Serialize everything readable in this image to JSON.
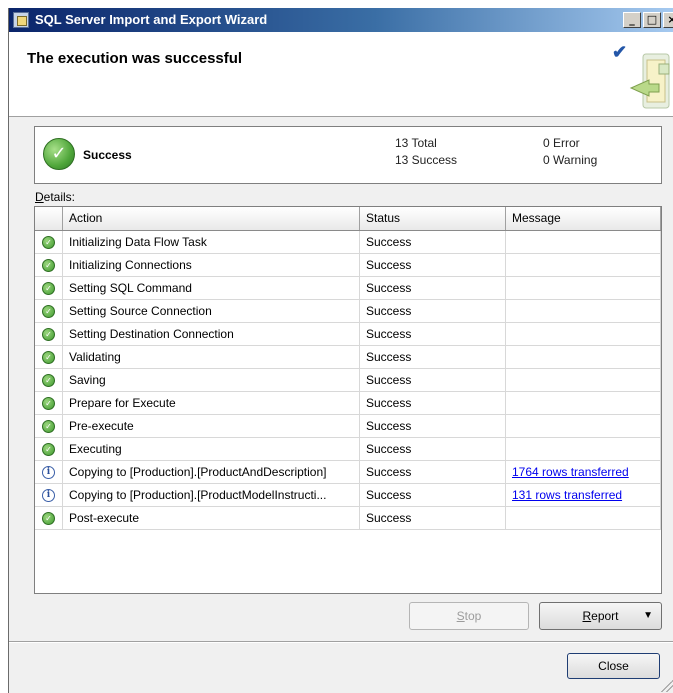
{
  "window": {
    "title": "SQL Server Import and Export Wizard",
    "controls": {
      "minimize": "_",
      "maximize": "□",
      "close": "×"
    }
  },
  "header": {
    "title": "The execution was successful"
  },
  "summary": {
    "status": "Success",
    "total": "13 Total",
    "success": "13 Success",
    "error": "0 Error",
    "warning": "0 Warning"
  },
  "details": {
    "label_accel": "D",
    "label_rest": "etails:",
    "columns": {
      "action": "Action",
      "status": "Status",
      "message": "Message"
    },
    "rows": [
      {
        "icon": "success",
        "action": "Initializing Data Flow Task",
        "status": "Success",
        "message": ""
      },
      {
        "icon": "success",
        "action": "Initializing Connections",
        "status": "Success",
        "message": ""
      },
      {
        "icon": "success",
        "action": "Setting SQL Command",
        "status": "Success",
        "message": ""
      },
      {
        "icon": "success",
        "action": "Setting Source Connection",
        "status": "Success",
        "message": ""
      },
      {
        "icon": "success",
        "action": "Setting Destination Connection",
        "status": "Success",
        "message": ""
      },
      {
        "icon": "success",
        "action": "Validating",
        "status": "Success",
        "message": ""
      },
      {
        "icon": "success",
        "action": "Saving",
        "status": "Success",
        "message": ""
      },
      {
        "icon": "success",
        "action": "Prepare for Execute",
        "status": "Success",
        "message": ""
      },
      {
        "icon": "success",
        "action": "Pre-execute",
        "status": "Success",
        "message": ""
      },
      {
        "icon": "success",
        "action": "Executing",
        "status": "Success",
        "message": ""
      },
      {
        "icon": "info",
        "action": "Copying to [Production].[ProductAndDescription]",
        "status": "Success",
        "message": "1764 rows transferred"
      },
      {
        "icon": "info",
        "action": "Copying to [Production].[ProductModelInstructi...",
        "status": "Success",
        "message": "131 rows transferred"
      },
      {
        "icon": "success",
        "action": "Post-execute",
        "status": "Success",
        "message": ""
      }
    ]
  },
  "buttons": {
    "stop_accel": "S",
    "stop_rest": "top",
    "report_accel": "R",
    "report_rest": "eport",
    "report_caret": "▼",
    "close": "Close"
  },
  "icons": {
    "success": "check-circle-icon",
    "info": "info-circle-icon"
  },
  "colors": {
    "title_bar": "#0a246a",
    "success_green": "#4fa63a",
    "link_blue": "#0000ee"
  }
}
